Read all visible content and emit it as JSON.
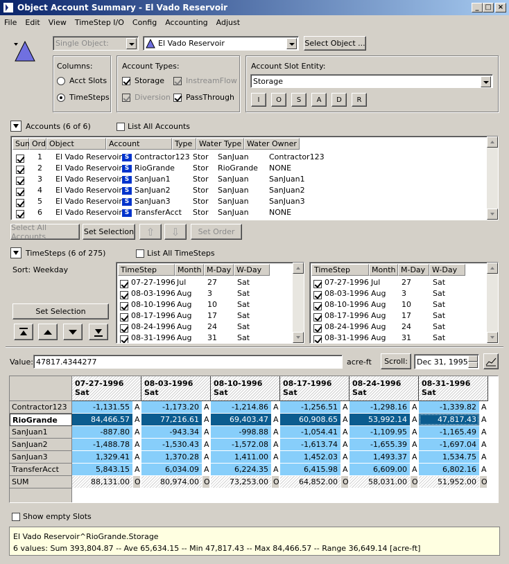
{
  "window": {
    "title": "Object Account Summary - El Vado Reservoir",
    "min_icon": "minimize-icon",
    "max_icon": "maximize-icon",
    "close_icon": "close-icon"
  },
  "menu": [
    "File",
    "Edit",
    "View",
    "TimeStep I/O",
    "Config",
    "Accounting",
    "Adjust"
  ],
  "object": {
    "mode": "Single Object:",
    "name": "El Vado Reservoir",
    "select_button": "Select Object ..."
  },
  "columns": {
    "title": "Columns:",
    "opt1": "Acct Slots",
    "opt2": "TimeSteps",
    "selected": "TimeSteps"
  },
  "account_types": {
    "title": "Account Types:",
    "storage": "Storage",
    "instream": "InstreamFlow",
    "diversion": "Diversion",
    "passthrough": "PassThrough"
  },
  "slot_entity": {
    "title": "Account Slot Entity:",
    "value": "Storage",
    "buttons": [
      "I",
      "O",
      "S",
      "A",
      "D",
      "R"
    ]
  },
  "accounts": {
    "toggle_label": "Accounts  (6 of 6)",
    "list_all": "List All Accounts",
    "headers": [
      "Sum",
      "Ord",
      "Object",
      "Account",
      "Type",
      "Water Type",
      "Water Owner"
    ],
    "rows": [
      {
        "ord": "1",
        "object": "El Vado Reservoir",
        "badge": "S",
        "account": "Contractor123",
        "type": "Stor",
        "water_type": "SanJuan",
        "owner": "Contractor123"
      },
      {
        "ord": "2",
        "object": "El Vado Reservoir",
        "badge": "S",
        "account": "RioGrande",
        "type": "Stor",
        "water_type": "RioGrande",
        "owner": "NONE"
      },
      {
        "ord": "3",
        "object": "El Vado Reservoir",
        "badge": "S",
        "account": "SanJuan1",
        "type": "Stor",
        "water_type": "SanJuan",
        "owner": "SanJuan1"
      },
      {
        "ord": "4",
        "object": "El Vado Reservoir",
        "badge": "S",
        "account": "SanJuan2",
        "type": "Stor",
        "water_type": "SanJuan",
        "owner": "SanJuan2"
      },
      {
        "ord": "5",
        "object": "El Vado Reservoir",
        "badge": "S",
        "account": "SanJuan3",
        "type": "Stor",
        "water_type": "SanJuan",
        "owner": "SanJuan3"
      },
      {
        "ord": "6",
        "object": "El Vado Reservoir",
        "badge": "S",
        "account": "TransferAcct",
        "type": "Stor",
        "water_type": "SanJuan",
        "owner": "NONE"
      }
    ],
    "select_all": "Select All Accounts",
    "set_selection": "Set Selection",
    "set_order": "Set Order"
  },
  "timesteps": {
    "toggle_label": "TimeSteps  (6 of 275)",
    "list_all": "List All TimeSteps",
    "sort_label": "Sort: Weekday",
    "set_selection": "Set Selection",
    "headers": [
      "TimeStep",
      "Month",
      "M-Day",
      "W-Day"
    ],
    "rows": [
      {
        "ts": "07-27-1996",
        "month": "Jul",
        "mday": "27",
        "wday": "Sat"
      },
      {
        "ts": "08-03-1996",
        "month": "Aug",
        "mday": "3",
        "wday": "Sat"
      },
      {
        "ts": "08-10-1996",
        "month": "Aug",
        "mday": "10",
        "wday": "Sat"
      },
      {
        "ts": "08-17-1996",
        "month": "Aug",
        "mday": "17",
        "wday": "Sat"
      },
      {
        "ts": "08-24-1996",
        "month": "Aug",
        "mday": "24",
        "wday": "Sat"
      },
      {
        "ts": "08-31-1996",
        "month": "Aug",
        "mday": "31",
        "wday": "Sat"
      }
    ]
  },
  "value_bar": {
    "label": "Value:",
    "value": "47817.4344277",
    "unit": "acre-ft",
    "scroll": "Scroll:",
    "date": "Dec 31, 1995"
  },
  "grid": {
    "columns": [
      {
        "date": "07-27-1996",
        "day": "Sat"
      },
      {
        "date": "08-03-1996",
        "day": "Sat"
      },
      {
        "date": "08-10-1996",
        "day": "Sat"
      },
      {
        "date": "08-17-1996",
        "day": "Sat"
      },
      {
        "date": "08-24-1996",
        "day": "Sat"
      },
      {
        "date": "08-31-1996",
        "day": "Sat"
      }
    ],
    "rows": [
      {
        "label": "Contractor123",
        "values": [
          "-1,131.55",
          "-1,173.20",
          "-1,214.86",
          "-1,256.51",
          "-1,298.16",
          "-1,339.82"
        ],
        "flags": [
          "A",
          "A",
          "A",
          "A",
          "A",
          "A"
        ]
      },
      {
        "label": "RioGrande",
        "values": [
          "84,466.57",
          "77,216.61",
          "69,403.47",
          "60,908.65",
          "53,992.14",
          "47,817.43"
        ],
        "flags": [
          "A",
          "A",
          "A",
          "A",
          "A",
          "A"
        ]
      },
      {
        "label": "SanJuan1",
        "values": [
          "-887.80",
          "-943.34",
          "-998.88",
          "-1,054.41",
          "-1,109.95",
          "-1,165.49"
        ],
        "flags": [
          "A",
          "A",
          "A",
          "A",
          "A",
          "A"
        ]
      },
      {
        "label": "SanJuan2",
        "values": [
          "-1,488.78",
          "-1,530.43",
          "-1,572.08",
          "-1,613.74",
          "-1,655.39",
          "-1,697.04"
        ],
        "flags": [
          "A",
          "A",
          "A",
          "A",
          "A",
          "A"
        ]
      },
      {
        "label": "SanJuan3",
        "values": [
          "1,329.41",
          "1,370.28",
          "1,411.00",
          "1,452.03",
          "1,493.37",
          "1,534.75"
        ],
        "flags": [
          "A",
          "A",
          "A",
          "A",
          "A",
          "A"
        ]
      },
      {
        "label": "TransferAcct",
        "values": [
          "5,843.15",
          "6,034.09",
          "6,224.35",
          "6,415.98",
          "6,609.00",
          "6,802.16"
        ],
        "flags": [
          "A",
          "A",
          "A",
          "A",
          "A",
          "A"
        ]
      },
      {
        "label": "SUM",
        "values": [
          "88,131.00",
          "80,974.00",
          "73,253.00",
          "64,852.00",
          "58,031.00",
          "51,952.00"
        ],
        "flags": [
          "O",
          "O",
          "O",
          "O",
          "O",
          "O"
        ]
      }
    ]
  },
  "show_empty": "Show empty Slots",
  "status": {
    "line1": "El Vado Reservoir^RioGrande.Storage",
    "line2": "6 values:  Sum 393,804.87 -- Ave 65,634.15 -- Min 47,817.43 -- Max 84,466.57 -- Range 36,649.14 [acre-ft]"
  },
  "colors": {
    "cell": "#87cefa",
    "selected": "#0b5c8f",
    "sum": "#ffffff"
  }
}
